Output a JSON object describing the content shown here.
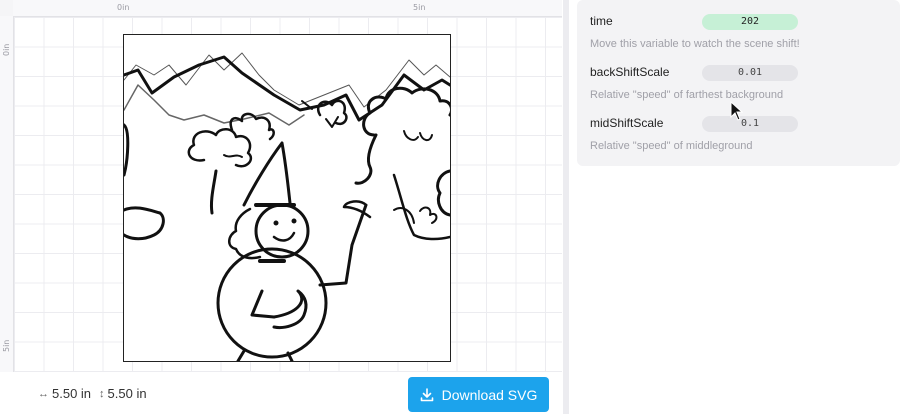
{
  "rulers": {
    "top_labels": [
      "0in",
      "5in"
    ],
    "left_labels": [
      "0in",
      "5in"
    ]
  },
  "canvas": {
    "width_label": "5.50 in",
    "height_label": "5.50 in",
    "download_label": "Download SVG"
  },
  "variables": [
    {
      "name": "time",
      "value": "202",
      "description": "Move this variable to watch the scene shift!",
      "active": true
    },
    {
      "name": "backShiftScale",
      "value": "0.01",
      "description": "Relative \"speed\" of farthest background",
      "active": false
    },
    {
      "name": "midShiftScale",
      "value": "0.1",
      "description": "Relative \"speed\" of middleground",
      "active": false
    }
  ],
  "icons": {
    "width_arrow": "horizontal-arrow-icon",
    "height_arrow": "vertical-arrow-icon",
    "download": "download-icon",
    "cursor": "mouse-pointer-icon"
  }
}
